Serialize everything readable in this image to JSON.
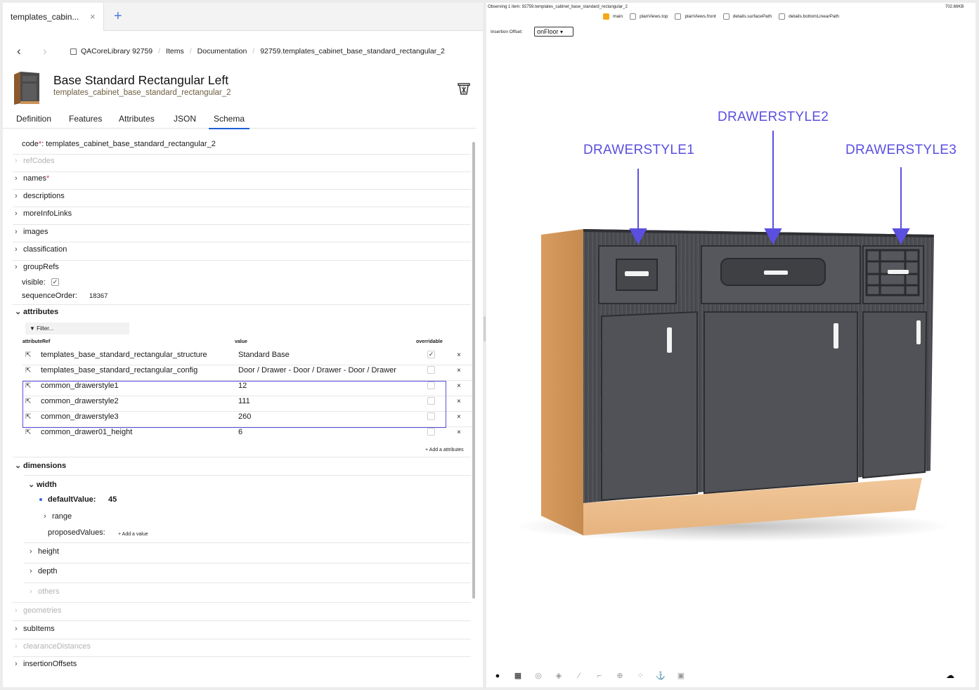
{
  "tab": {
    "label": "templates_cabin...",
    "close": "×",
    "add": "+"
  },
  "nav": {
    "back": "‹",
    "forward": "›"
  },
  "breadcrumb": [
    "QACoreLibrary 92759",
    "Items",
    "Documentation",
    "92759.templates_cabinet_base_standard_rectangular_2"
  ],
  "item": {
    "title": "Base Standard Rectangular Left",
    "code": "templates_cabinet_base_standard_rectangular_2"
  },
  "subtabs": [
    "Definition",
    "Features",
    "Attributes",
    "JSON",
    "Schema"
  ],
  "active_subtab": "Schema",
  "schema": {
    "code_label": "code",
    "code_value": "templates_cabinet_base_standard_rectangular_2",
    "refCodes": "refCodes",
    "names": "names",
    "descriptions": "descriptions",
    "moreInfoLinks": "moreInfoLinks",
    "images": "images",
    "classification": "classification",
    "groupRefs": "groupRefs",
    "visible_label": "visible:",
    "visible_checked": true,
    "sequenceOrder_label": "sequenceOrder:",
    "sequenceOrder_value": "18367",
    "attributes": "attributes",
    "filter_label": "Filter...",
    "col_ref": "attributeRef",
    "col_value": "value",
    "col_overridable": "overridable",
    "attr_rows": [
      {
        "ref": "templates_base_standard_rectangular_structure",
        "value": "Standard Base",
        "overridable": true
      },
      {
        "ref": "templates_base_standard_rectangular_config",
        "value": "Door / Drawer - Door / Drawer - Door / Drawer",
        "overridable": false
      },
      {
        "ref": "common_drawerstyle1",
        "value": "12",
        "overridable": false
      },
      {
        "ref": "common_drawerstyle2",
        "value": "111",
        "overridable": false
      },
      {
        "ref": "common_drawerstyle3",
        "value": "260",
        "overridable": false
      },
      {
        "ref": "common_drawer01_height",
        "value": "6",
        "overridable": false
      }
    ],
    "add_attr": "+ Add a attributes",
    "dimensions": "dimensions",
    "width": "width",
    "defaultValue_label": "defaultValue:",
    "defaultValue": "45",
    "range": "range",
    "proposedValues": "proposedValues:",
    "add_value": "+ Add a value",
    "height": "height",
    "depth": "depth",
    "others": "others",
    "geometries": "geometries",
    "subItems": "subItems",
    "clearanceDistances": "clearanceDistances",
    "insertionOffsets": "insertionOffsets"
  },
  "viewer": {
    "observing": "Observing 1 item: 92759.templates_cabinet_base_standard_rectangular_2",
    "size": "702.66KB",
    "views": [
      {
        "label": "main",
        "checked": true
      },
      {
        "label": "planViews.top",
        "checked": false
      },
      {
        "label": "planViews.front",
        "checked": false
      },
      {
        "label": "details.surfacePath",
        "checked": false
      },
      {
        "label": "details.bottomLinearPath",
        "checked": false
      }
    ],
    "insertion_label": "Insertion Offset:",
    "insertion_value": "onFloor",
    "annotations": [
      "DRAWERSTYLE1",
      "DRAWERSTYLE2",
      "DRAWERSTYLE3"
    ],
    "accent": "#5b4fe0"
  }
}
